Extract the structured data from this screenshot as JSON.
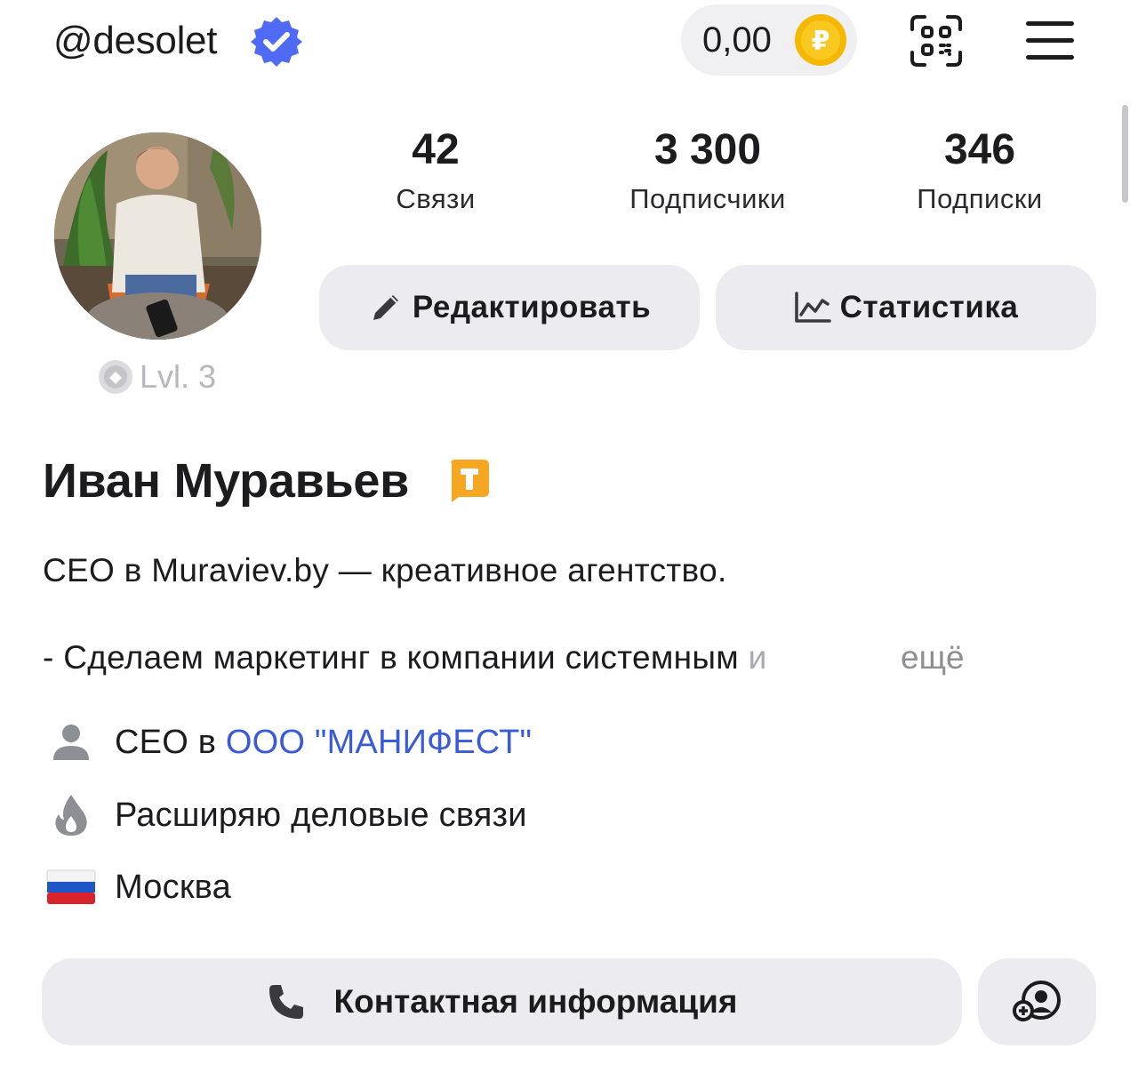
{
  "header": {
    "username": "@desolet",
    "balance": "0,00",
    "currency_icon": "ruble-coin-icon",
    "colors": {
      "verified": "#4f6bf5",
      "coin": "#f5b800"
    }
  },
  "stats": [
    {
      "value": "42",
      "label": "Связи"
    },
    {
      "value": "3 300",
      "label": "Подписчики"
    },
    {
      "value": "346",
      "label": "Подписки"
    }
  ],
  "actions": {
    "edit_label": "Редактировать",
    "stats_label": "Статистика"
  },
  "level": "Lvl. 3",
  "profile": {
    "name": "Иван Муравьев",
    "bio_line1": "CEO в Muraviev.by — креативное агентство.",
    "bio_line2": "- Сделаем маркетинг в компании системным",
    "bio_line2_fade": " и",
    "more_label": "ещё"
  },
  "info": {
    "job_prefix": "CEO в",
    "job_company": "ООО \"МАНИФЕСТ\"",
    "goal": "Расширяю деловые связи",
    "city": "Москва"
  },
  "footer": {
    "contact_label": "Контактная информация"
  }
}
